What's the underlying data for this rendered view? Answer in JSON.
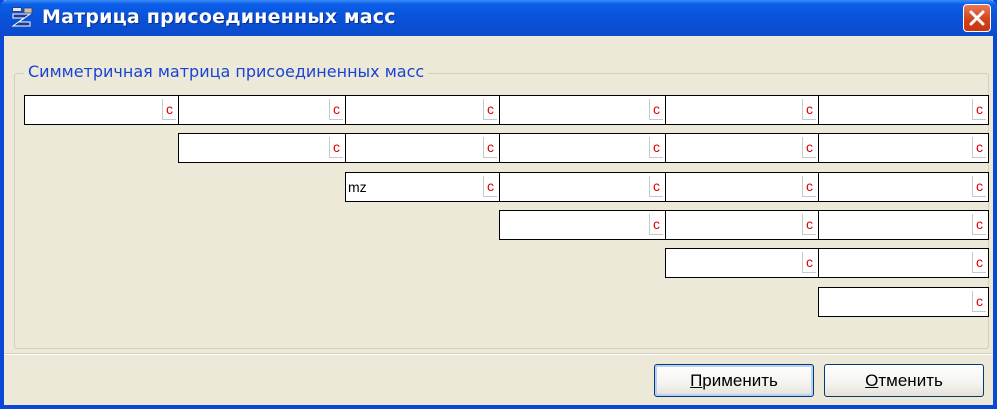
{
  "window": {
    "title": "Матрица присоединенных масс",
    "icon": "app-matrix-icon",
    "close_icon": "close-icon"
  },
  "group": {
    "title": "Симметричная матрица присоединенных масс"
  },
  "matrix": {
    "cell_button_label": "c",
    "rows": [
      [
        "",
        "",
        "",
        "",
        "",
        ""
      ],
      [
        "",
        "",
        "",
        "",
        ""
      ],
      [
        "mz",
        "",
        "",
        ""
      ],
      [
        "",
        "",
        ""
      ],
      [
        "",
        ""
      ],
      [
        ""
      ]
    ]
  },
  "buttons": {
    "apply_first": "П",
    "apply_rest": "рименить",
    "cancel_first": "О",
    "cancel_rest": "тменить"
  },
  "colors": {
    "title_bar": "#0A53D9",
    "close_button": "#D5431B",
    "group_title": "#1A43D3",
    "cell_button_text": "#E00000"
  }
}
